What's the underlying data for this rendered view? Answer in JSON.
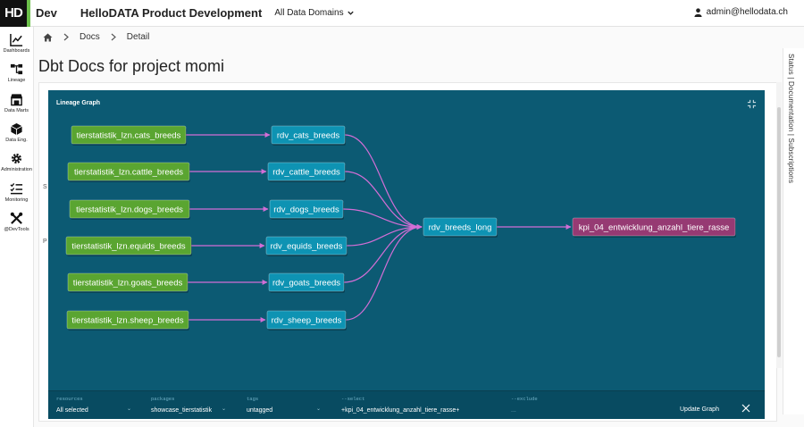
{
  "header": {
    "logo_text": "HD",
    "env": "Dev",
    "title": "HelloDATA Product Development",
    "domain_select": "All Data Domains",
    "user": "admin@hellodata.ch"
  },
  "sidebar": {
    "items": [
      {
        "label": "Dashboards",
        "icon": "chart-line-icon"
      },
      {
        "label": "Lineage",
        "icon": "lineage-icon"
      },
      {
        "label": "Data Marts",
        "icon": "store-icon"
      },
      {
        "label": "Data Eng.",
        "icon": "cube-icon"
      },
      {
        "label": "Administration",
        "icon": "gear-icon"
      },
      {
        "label": "Monitoring",
        "icon": "checklist-icon"
      },
      {
        "label": "@DevTools",
        "icon": "tools-icon"
      }
    ]
  },
  "breadcrumb": {
    "items": [
      "Docs",
      "Detail"
    ]
  },
  "page_title": "Dbt Docs for project momi",
  "right_tabs": "Status | Documentation | Subscriptions",
  "side_letters": [
    "S",
    "P"
  ],
  "lineage": {
    "title": "Lineage Graph",
    "sources": [
      "tierstatistik_lzn.cats_breeds",
      "tierstatistik_lzn.cattle_breeds",
      "tierstatistik_lzn.dogs_breeds",
      "tierstatistik_lzn.equids_breeds",
      "tierstatistik_lzn.goats_breeds",
      "tierstatistik_lzn.sheep_breeds"
    ],
    "staging": [
      "rdv_cats_breeds",
      "rdv_cattle_breeds",
      "rdv_dogs_breeds",
      "rdv_equids_breeds",
      "rdv_goats_breeds",
      "rdv_sheep_breeds"
    ],
    "merge": "rdv_breeds_long",
    "target": "kpi_04_entwicklung_anzahl_tiere_rasse",
    "colors": {
      "source": "#5aa531",
      "model": "#0e93b3",
      "target": "#963a73",
      "edge": "#d36ed6",
      "panel": "#0c5a73"
    }
  },
  "filters": {
    "resources": {
      "label": "resources",
      "value": "All selected"
    },
    "packages": {
      "label": "packages",
      "value": "showcase_tierstatistik"
    },
    "tags": {
      "label": "tags",
      "value": "untagged"
    },
    "select": {
      "label": "--select",
      "value": "+kpi_04_entwicklung_anzahl_tiere_rasse+"
    },
    "exclude": {
      "label": "--exclude",
      "value": "..."
    },
    "update_button": "Update Graph"
  }
}
